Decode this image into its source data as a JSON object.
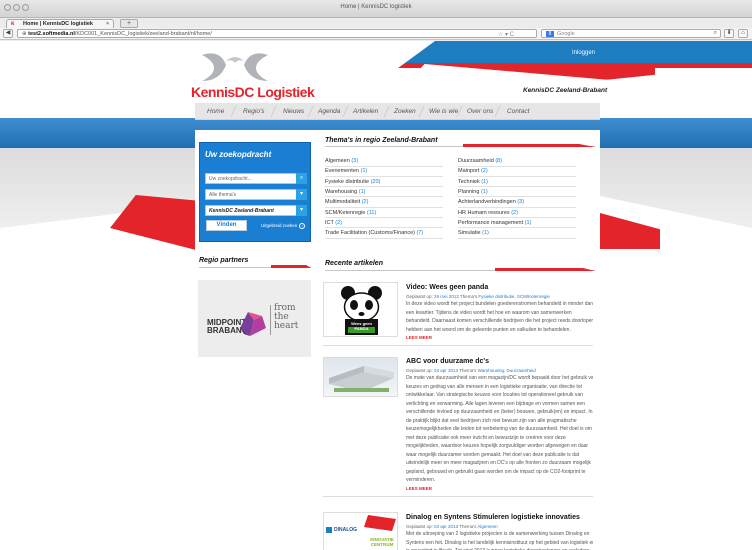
{
  "browser": {
    "window_title": "Home | KennisDC logistiek",
    "tab_title": "Home | KennisDC logistiek",
    "url_host": "test2.softmedia.nl",
    "url_path": "/KDC001_KennisDC_logistiek/zeeland-brabant/nl/home/",
    "search_engine": "Google",
    "new_tab": "+",
    "back": "◀",
    "close_tab": "×"
  },
  "header": {
    "login": "Inloggen",
    "logo": "KennisDC Logistiek",
    "tagline": "KennisDC Zeeland-Brabant"
  },
  "nav": [
    "Home",
    "Regio's",
    "Nieuws",
    "Agenda",
    "Artikelen",
    "Zoeken",
    "Wie is wie",
    "Over ons",
    "Contact"
  ],
  "search": {
    "title": "Uw zoekopdracht",
    "placeholder": "Uw zoekopdracht...",
    "themes_select": "Alle thema's",
    "region_select": "KennisDC Zeeland-Brabant",
    "submit": "Vinden",
    "advanced": "Uitgebreid zoeken"
  },
  "themes": {
    "heading": "Thema's in regio Zeeland-Brabant",
    "left": [
      {
        "name": "Algemeen",
        "count": "(3)"
      },
      {
        "name": "Evenementen",
        "count": "(1)"
      },
      {
        "name": "Fysieke distributie",
        "count": "(20)"
      },
      {
        "name": "Warehousing",
        "count": "(1)"
      },
      {
        "name": "Multimodaliteit",
        "count": "(2)"
      },
      {
        "name": "SCM/Ketenregie",
        "count": "(11)"
      },
      {
        "name": "ICT",
        "count": "(2)"
      },
      {
        "name": "Trade Facilitation (Customs/Finance)",
        "count": "(7)"
      }
    ],
    "right": [
      {
        "name": "Duurzaamheid",
        "count": "(8)"
      },
      {
        "name": "Mainport",
        "count": "(2)"
      },
      {
        "name": "Techniek",
        "count": "(1)"
      },
      {
        "name": "Planning",
        "count": "(1)"
      },
      {
        "name": "Achterlandverbindingen",
        "count": "(3)"
      },
      {
        "name": "HR Humam resoures",
        "count": "(2)"
      },
      {
        "name": "Performance management",
        "count": "(1)"
      },
      {
        "name": "Simulatie",
        "count": "(1)"
      }
    ]
  },
  "partners": {
    "heading": "Regio partners",
    "logo_name": "MIDPOINT BRABANT",
    "slogan": "from the heart"
  },
  "articles": {
    "heading": "Recente artikelen",
    "read_more": "LEES MEER",
    "items": [
      {
        "title": "Video: Wees geen panda",
        "meta_prefix": "Geplaatst op:",
        "date": "29 mei 2013",
        "theme_prefix": "Thema's",
        "themes": "Fysieke distributie, SCM/Ketenregie",
        "lines": [
          "In deze video wordt het project bundelen goederenstromen behandeld in minder dan",
          "een kwartier. Tijdens de video wordt het hoe en waarom van samenwerken",
          "behandeld. Daarnaast komen verschillende bedrijven die het project reeds doorlopen",
          "hebben aan het woord om de geleerde punten en valkuilen te behandelen."
        ]
      },
      {
        "title": "ABC voor duurzame dc's",
        "meta_prefix": "Geplaatst op:",
        "date": "03 apr 2013",
        "theme_prefix": "Thema's",
        "themes": "Warehousing, Duurzaamheid",
        "lines": [
          "De mate van duurzaamheid van een magazijn/DC wordt bepaald door het gebruik van",
          "keuzes en gedrag van alle mensen in een logistieke organisatie, van directie tot",
          "ontwikkelaar. Van strategische keuzes voor locaties tot operationeel gebruik van",
          "verlichting en verwarming. Alle lagen leveren een bijdrage en vormen samen een",
          "verschillende invloed op duurzaamheid en (beter) bouwen, gebruik(en) en impact. In",
          "de praktijk blijkt dat veel bedrijven zich niet bewust zijn van alle pragmatische",
          "keuzemogelijkheden die leiden tot verbetering van de duurzaamheid. Het doel is om",
          "met deze publicatie ook meer inzicht en bewustzijn te creëren voor deze",
          "mogelijkheden, waardoor keuzes hopelijk zorgvuldiger worden afgewogen en daar",
          "waar mogelijk duurzamer worden gemaakt. Het doel van deze publicatie is dat",
          "uiteindelijk meer en meer magazijnen en DC's op alle fronten zo duurzaam mogelijk",
          "gepland, gebouwd en gebruikt gaan worden om de impact op de CO2-footprint te",
          "verminderen."
        ]
      },
      {
        "title": "Dinalog en Syntens Stimuleren logistieke innovaties",
        "meta_prefix": "Geplaatst op:",
        "date": "03 apr 2013",
        "theme_prefix": "Thema's",
        "themes": "Algemeen",
        "lines": [
          "Met de uitroeping van 2 logistieke projecten is de samenwerking tussen Dinalog en",
          "Syntens een feit. Dinalog is het landelijk kennisinstituut op het gebied van logistiek en",
          "is gevestigd in Breda. Tot eind 2013 kunnen logistieke dienstverleners en verladers"
        ]
      }
    ],
    "img2_label": "INNOVATIE CENTRUM",
    "img3_brand": "DINALOG",
    "img1_caption": "Wees geen PANDA"
  },
  "colors": {
    "blue": "#1e7cc1",
    "red": "#e3242b",
    "link": "#1a7fd3"
  }
}
